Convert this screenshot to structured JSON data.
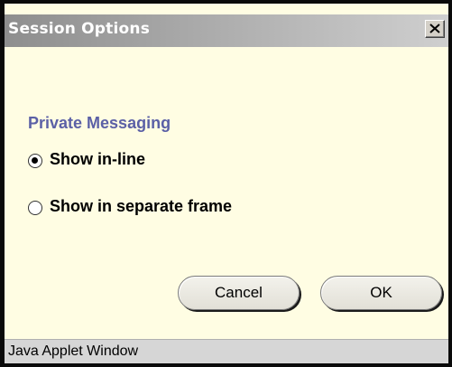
{
  "window": {
    "title": "Session Options",
    "status_text": "Java Applet Window"
  },
  "section": {
    "heading": "Private Messaging",
    "options": [
      {
        "label": "Show in-line",
        "selected": true
      },
      {
        "label": "Show in separate frame",
        "selected": false
      }
    ]
  },
  "buttons": {
    "cancel": "Cancel",
    "ok": "OK"
  },
  "colors": {
    "heading": "#5b60a6",
    "background": "#fffde3",
    "statusbar": "#d6d6d6"
  }
}
